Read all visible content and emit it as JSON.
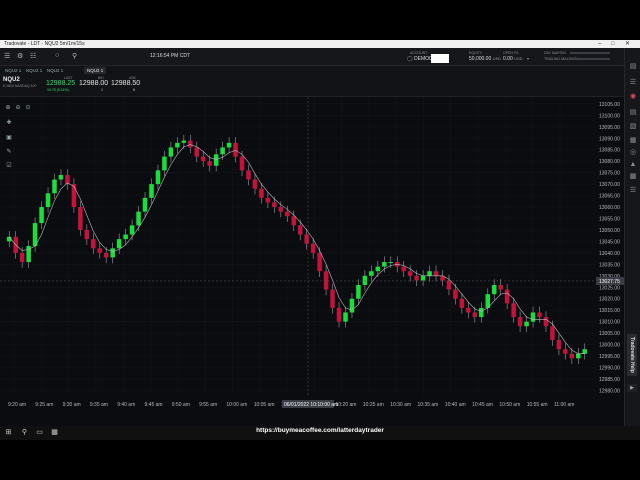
{
  "window": {
    "title": "Tradovate - LDT - NQU2 5m/1m/15s"
  },
  "topbar": {
    "time": "12:16:54 PM CDT",
    "account_label": "ACCOUNT",
    "account_value": "DEMO03",
    "equity_label": "EQUITY",
    "equity_value": "50,000.00",
    "equity_unit": "USD",
    "open_pl_label": "OPEN P/L",
    "open_pl_value": "0.00",
    "open_pl_unit": "USD",
    "day_margin_label": "DAY MARGIN",
    "trail_margin_label": "TRAILING MAXIMUM"
  },
  "tabs": [
    {
      "label": "NQU2 1"
    },
    {
      "label": "NQU2 1"
    },
    {
      "label": "NQU2 1"
    },
    {
      "label": "NQU2 1"
    }
  ],
  "quote": {
    "symbol": "NQU2",
    "description": "E-MINI NASDAQ 100",
    "last_label": "LAST",
    "last": "12988.25",
    "change": "10.75 (0.11%)",
    "bid_label": "BID",
    "bid": "12988.00",
    "bid_size": "1",
    "ask_label": "ASK",
    "ask": "12988.50",
    "ask_size": "6"
  },
  "colors": {
    "up": "#17e03d",
    "down": "#c5123a",
    "background": "#0b0c0f",
    "ma_line": "#b9bcc6"
  },
  "icons": [
    "zoom-in-icon",
    "zoom-out-icon",
    "crosshair-icon",
    "trash-icon",
    "pencil-icon",
    "lock-icon"
  ],
  "chart_data": {
    "type": "candlestick",
    "interval": "15s",
    "x_ticks": [
      "9:20 am",
      "9:25 am",
      "9:30 am",
      "9:35 am",
      "9:40 am",
      "9:45 am",
      "9:50 am",
      "9:55 am",
      "10:00 am",
      "10:05 am",
      "10:10 am",
      "10:15 am",
      "10:20 am",
      "10:25 am",
      "10:30 am",
      "10:35 am",
      "10:40 am",
      "10:45 am",
      "10:50 am",
      "10:55 am",
      "11:00 am"
    ],
    "y_ticks": [
      "13105.00",
      "13100.00",
      "13095.00",
      "13090.00",
      "13085.00",
      "13080.00",
      "13075.00",
      "13070.00",
      "13065.00",
      "13060.00",
      "13055.00",
      "13050.00",
      "13045.00",
      "13040.00",
      "13035.00",
      "13030.00",
      "13025.00",
      "13020.00",
      "13015.00",
      "13010.00",
      "13005.00",
      "13000.00",
      "12995.00",
      "12990.00",
      "12985.00",
      "12980.00"
    ],
    "ylim": [
      12978,
      13108
    ],
    "crosshair_date": "06/01/2022 10:10:00 am",
    "crosshair_price": "13027.75",
    "closes": [
      13047,
      13040,
      13036,
      13043,
      13053,
      13060,
      13066,
      13072,
      13074,
      13070,
      13060,
      13050,
      13046,
      13042,
      13040,
      13038,
      13042,
      13046,
      13048,
      13052,
      13058,
      13064,
      13070,
      13076,
      13082,
      13086,
      13088,
      13089,
      13086,
      13082,
      13080,
      13078,
      13083,
      13086,
      13088,
      13082,
      13076,
      13072,
      13068,
      13064,
      13062,
      13060,
      13058,
      13056,
      13052,
      13048,
      13044,
      13040,
      13032,
      13024,
      13016,
      13010,
      13014,
      13020,
      13026,
      13030,
      13032,
      13034,
      13036,
      13036,
      13034,
      13032,
      13030,
      13028,
      13030,
      13032,
      13030,
      13028,
      13024,
      13020,
      13016,
      13014,
      13012,
      13016,
      13022,
      13026,
      13024,
      13018,
      13012,
      13008,
      13010,
      13014,
      13012,
      13008,
      13002,
      12998,
      12996,
      12994,
      12996,
      12998
    ]
  }
}
